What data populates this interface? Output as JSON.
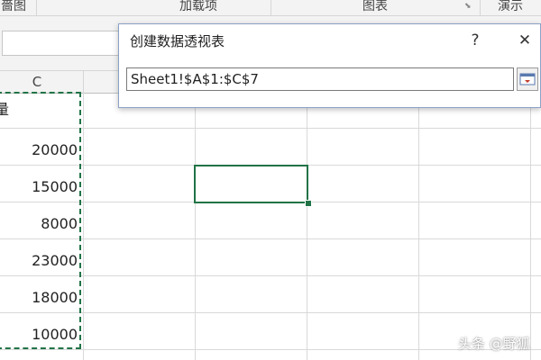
{
  "ribbon": {
    "groups": [
      "嗇图",
      "加载项",
      "图表",
      "演示"
    ]
  },
  "sheet": {
    "column_c": "C",
    "header_partial": "量",
    "values": [
      "20000",
      "15000",
      "8000",
      "23000",
      "18000",
      "10000"
    ]
  },
  "dialog": {
    "title": "创建数据透视表",
    "help_label": "?",
    "close_label": "✕",
    "range_value": "Sheet1!$A$1:$C$7",
    "collapse_icon": "collapse-dialog-icon"
  },
  "watermark": "头条 @野狐",
  "colors": {
    "accent": "#217346",
    "dialog_border": "#8aa1c7"
  }
}
